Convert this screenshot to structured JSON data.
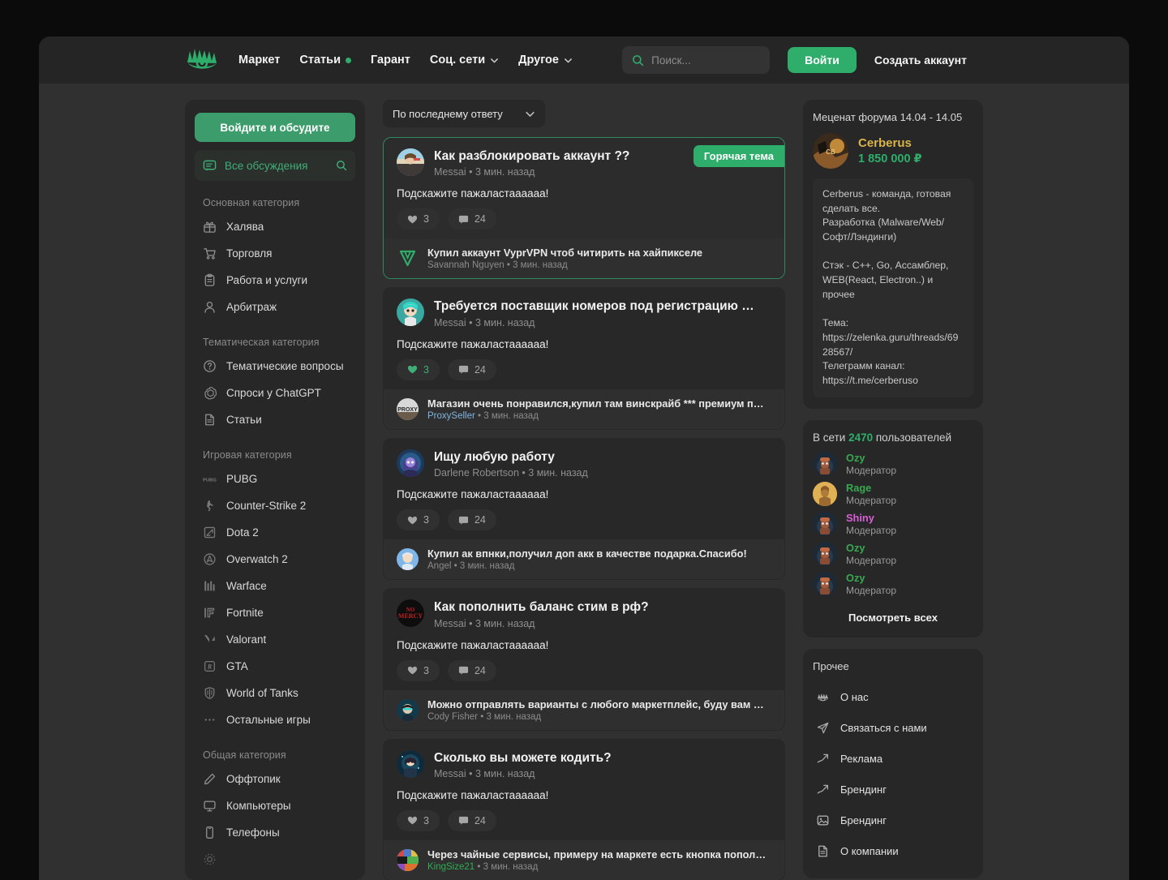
{
  "header": {
    "logo_icon": "eye-logo-icon",
    "nav": [
      {
        "label": "Маркет",
        "dot": false,
        "chevron": false
      },
      {
        "label": "Статьи",
        "dot": true,
        "chevron": false
      },
      {
        "label": "Гарант",
        "dot": false,
        "chevron": false
      },
      {
        "label": "Соц. сети",
        "dot": false,
        "chevron": true
      },
      {
        "label": "Другое",
        "dot": false,
        "chevron": true
      }
    ],
    "search_placeholder": "Поиск...",
    "login_label": "Войти",
    "register_label": "Создать аккаунт"
  },
  "sidebar": {
    "discuss_button": "Войдите и обсудите",
    "all_discussions": "Все обсуждения",
    "groups": [
      {
        "title": "Основная категория",
        "items": [
          {
            "label": "Халява",
            "icon": "gift-icon"
          },
          {
            "label": "Торговля",
            "icon": "cart-icon"
          },
          {
            "label": "Работа и услуги",
            "icon": "clipboard-icon"
          },
          {
            "label": "Арбитраж",
            "icon": "user-icon"
          }
        ]
      },
      {
        "title": "Тематическая категория",
        "items": [
          {
            "label": "Тематические вопросы",
            "icon": "question-circle-icon"
          },
          {
            "label": "Спроси у ChatGPT",
            "icon": "chatgpt-icon"
          },
          {
            "label": "Статьи",
            "icon": "document-icon"
          }
        ]
      },
      {
        "title": "Игровая категория",
        "items": [
          {
            "label": "PUBG",
            "icon": "pubg-icon"
          },
          {
            "label": "Counter-Strike 2",
            "icon": "cs2-icon"
          },
          {
            "label": "Dota 2",
            "icon": "dota2-icon"
          },
          {
            "label": "Overwatch 2",
            "icon": "overwatch-icon"
          },
          {
            "label": "Warface",
            "icon": "warface-icon"
          },
          {
            "label": "Fortnite",
            "icon": "fortnite-icon"
          },
          {
            "label": "Valorant",
            "icon": "valorant-icon"
          },
          {
            "label": "GTA",
            "icon": "gta-icon"
          },
          {
            "label": "World of Tanks",
            "icon": "wot-icon"
          },
          {
            "label": "Остальные игры",
            "icon": "ellipsis-icon"
          }
        ]
      },
      {
        "title": "Общая категория",
        "items": [
          {
            "label": "Оффтопик",
            "icon": "pencil-icon"
          },
          {
            "label": "Компьютеры",
            "icon": "monitor-icon"
          },
          {
            "label": "Телефоны",
            "icon": "phone-icon"
          }
        ]
      }
    ]
  },
  "main": {
    "sort_label": "По последнему ответу",
    "hot_badge": "Горячая тема",
    "threads": [
      {
        "title": "Как разблокировать аккаунт ??",
        "author": "Messai",
        "time": "3 мин. назад",
        "body": "Подскажите пажаластаааааа!",
        "likes": "3",
        "comments": "24",
        "liked": false,
        "hot": true,
        "avatar": "avatar-beach-girl",
        "reply": {
          "text": "Купил аккаунт VyprVPN чтоб читирить на хайпикселе",
          "author": "Savannah Nguyen",
          "time": "3 мин. назад",
          "author_color": "grey",
          "avatar": "avatar-v-logo"
        }
      },
      {
        "title": "Требуется поставщик номеров под регистрацию телеграмма (...",
        "author": "Messai",
        "time": "3 мин. назад",
        "body": "Подскажите пажаластаааааа!",
        "likes": "3",
        "comments": "24",
        "liked": true,
        "hot": false,
        "avatar": "avatar-teal-character",
        "reply": {
          "text": "Магазин очень понравился,купил там винскрайб *** премиум про,момента...",
          "author": "ProxySeller",
          "time": "3 мин. назад",
          "author_color": "blue",
          "avatar": "avatar-proxy"
        }
      },
      {
        "title": "Ищу любую работу",
        "author": "Darlene Robertson",
        "time": "3 мин. назад",
        "body": "Подскажите пажаластаааааа!",
        "likes": "3",
        "comments": "24",
        "liked": false,
        "hot": false,
        "avatar": "avatar-blue-hood",
        "reply": {
          "text": "Купил ак впнки,получил доп акк в качестве подарка.Спасибо!",
          "author": "Angel",
          "time": "3 мин. назад",
          "author_color": "grey",
          "avatar": "avatar-angel"
        }
      },
      {
        "title": "Как пополнить баланс стим в рф?",
        "author": "Messai",
        "time": "3 мин. назад",
        "body": "Подскажите пажаластаааааа!",
        "likes": "3",
        "comments": "24",
        "liked": false,
        "hot": false,
        "avatar": "avatar-no-mercy",
        "reply": {
          "text": "Можно отправлять варианты с любого маркетплейс, буду вам очень благод...",
          "author": "Cody Fisher",
          "time": "3 мин. назад",
          "author_color": "grey",
          "avatar": "avatar-cyber-guy"
        }
      },
      {
        "title": "Сколько вы можете кодить?",
        "author": "Messai",
        "time": "3 мин. назад",
        "body": "Подскажите пажаластаааааа!",
        "likes": "3",
        "comments": "24",
        "liked": false,
        "hot": false,
        "avatar": "avatar-space-girl",
        "reply": {
          "text": "Через чайные сервисы, примеру на маркете есть кнопка пополн...",
          "author": "KingSize21",
          "time": "3 мин. назад",
          "author_color": "green",
          "avatar": "avatar-collage"
        }
      }
    ]
  },
  "rightbar": {
    "patron": {
      "title": "Меценат форума 14.04 - 14.05",
      "name": "Cerberus",
      "amount": "1 850 000 ₽",
      "description": "Cerberus - команда, готовая сделать все.\nРазработка (Malware/Web/Софт/Лэндинги)\n\nСтэк - C++, Go, Ассамблер, WEB(React, Electron..) и прочее\n\nТема:\nhttps://zelenka.guru/threads/6928567/\nТелеграмм канал:\nhttps://t.me/cerberuso"
    },
    "online": {
      "prefix": "В сети",
      "count": "2470",
      "suffix": "пользователей",
      "users": [
        {
          "name": "Ozy",
          "role": "Модератор",
          "color": "#39a851",
          "avatar": "avatar-robot"
        },
        {
          "name": "Rage",
          "role": "Модератор",
          "color": "#39a851",
          "avatar": "avatar-gold"
        },
        {
          "name": "Shiny",
          "role": "Модератор",
          "color": "#d95fd6",
          "avatar": "avatar-robot"
        },
        {
          "name": "Ozy",
          "role": "Модератор",
          "color": "#39a851",
          "avatar": "avatar-robot"
        },
        {
          "name": "Ozy",
          "role": "Модератор",
          "color": "#39a851",
          "avatar": "avatar-robot"
        }
      ],
      "see_all": "Посмотреть всех"
    },
    "misc": {
      "title": "Прочее",
      "items": [
        {
          "label": "О нас",
          "icon": "eye-icon"
        },
        {
          "label": "Связаться с нами",
          "icon": "send-icon"
        },
        {
          "label": "Реклама",
          "icon": "trend-up-icon"
        },
        {
          "label": "Брендинг",
          "icon": "trend-up-icon"
        },
        {
          "label": "Брендинг",
          "icon": "image-icon"
        },
        {
          "label": "О компании",
          "icon": "document-icon"
        }
      ]
    }
  },
  "colors": {
    "accent_green": "#2eae6a",
    "page_bg": "#0b0b0c",
    "window_bg": "#303031",
    "panel_bg": "#272728",
    "card_bg": "#282829",
    "gold": "#d9b44a"
  }
}
